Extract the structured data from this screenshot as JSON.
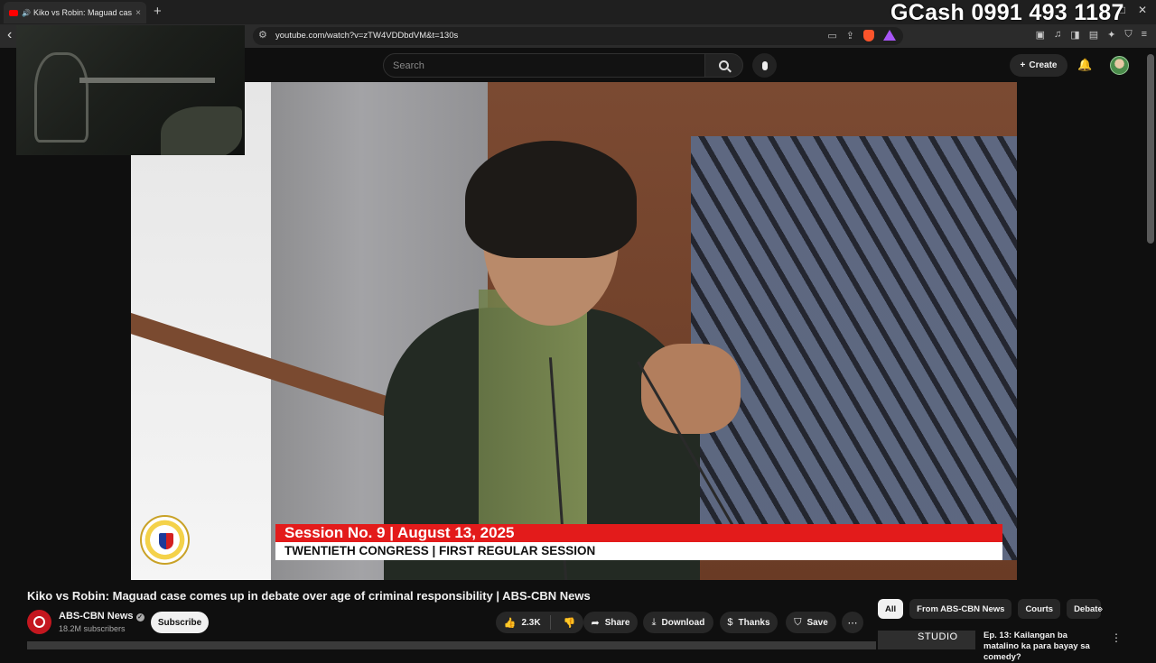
{
  "browser": {
    "tab_title": "Kiko vs Robin: Maguad case c",
    "tab_close": "×",
    "new_tab": "+",
    "url": "youtube.com/watch?v=zTW4VDDbdVM&t=130s"
  },
  "overlay": {
    "gcash_text": "GCash 0991 493 1187"
  },
  "header": {
    "search_placeholder": "Search",
    "create_label": "Create"
  },
  "video": {
    "lower_third_line1": "Session No. 9 | August 13, 2025",
    "lower_third_line2": "TWENTIETH  CONGRESS | FIRST REGULAR SESSION"
  },
  "watch": {
    "title": "Kiko vs Robin: Maguad case comes up in debate over age of criminal responsibility | ABS-CBN News",
    "channel_name": "ABS-CBN News",
    "subscribers": "18.2M subscribers",
    "subscribe_label": "Subscribe",
    "like_count": "2.3K",
    "share_label": "Share",
    "download_label": "Download",
    "thanks_label": "Thanks",
    "save_label": "Save"
  },
  "chips": [
    "All",
    "From ABS-CBN News",
    "Courts",
    "Debate"
  ],
  "recommendation": {
    "thumb_text": "STUDIO",
    "title": "Ep. 13: Kailangan ba matalino ka para bayay sa comedy?"
  },
  "colors": {
    "background": "#0f0f0f",
    "lower_third_red": "#e31b1b",
    "subscribe_bg": "#f1f1f1"
  }
}
